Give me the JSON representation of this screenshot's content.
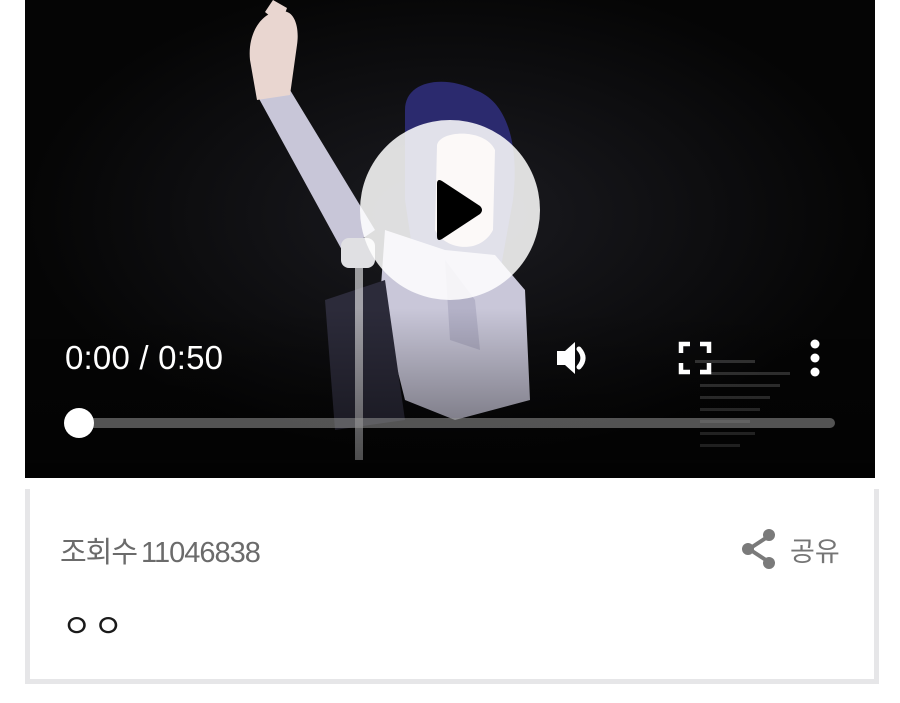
{
  "player": {
    "current_time": "0:00",
    "separator": "/",
    "duration": "0:50",
    "progress": 0,
    "icons": {
      "play": "play-icon",
      "volume": "volume-icon",
      "fullscreen": "fullscreen-icon",
      "more": "more-vertical-icon"
    }
  },
  "info": {
    "views_label": "조회수",
    "views_count": "11046838",
    "share_label": "공유",
    "title": "ㅇㅇ",
    "share_icon": "share-icon"
  },
  "colors": {
    "video_bg": "#050505",
    "meta_text": "#6b6b6b",
    "share_text": "#757575",
    "title_text": "#1a1a1a",
    "card_border": "#e6e6e8"
  }
}
